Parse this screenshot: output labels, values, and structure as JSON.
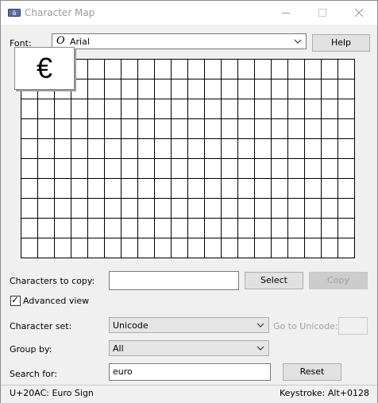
{
  "window": {
    "title": "Character Map"
  },
  "font": {
    "label": "Font:",
    "selected": "Arial",
    "font_icon_glyph": "O"
  },
  "help_label": "Help",
  "grid": {
    "rows": 10,
    "cols": 20
  },
  "zoom_char": "€",
  "copy_row": {
    "label": "Characters to copy:",
    "value": "",
    "select_label": "Select",
    "copy_label": "Copy"
  },
  "advanced": {
    "label": "Advanced view",
    "checked": true,
    "check_glyph": "✓"
  },
  "charset": {
    "label": "Character set:",
    "selected": "Unicode",
    "goto_label": "Go to Unicode:",
    "goto_value": ""
  },
  "groupby": {
    "label": "Group by:",
    "selected": "All"
  },
  "search": {
    "label": "Search for:",
    "value": "euro",
    "reset_label": "Reset"
  },
  "status": {
    "char_info": "U+20AC: Euro Sign",
    "keystroke": "Keystroke: Alt+0128"
  },
  "icons": {
    "app": "character-map-app-icon",
    "minimize": "minimize-icon",
    "maximize": "maximize-icon",
    "close": "close-icon",
    "dropdown": "chevron-down-icon",
    "font_type": "opentype-font-icon"
  }
}
